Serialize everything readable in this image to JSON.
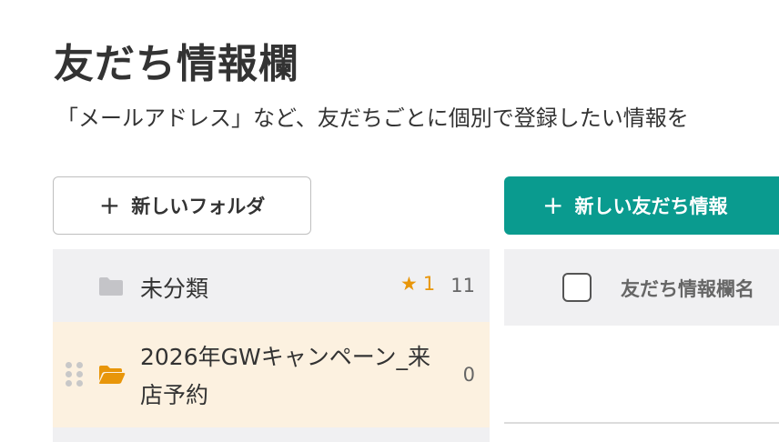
{
  "page": {
    "title": "友だち情報欄",
    "description": "「メールアドレス」など、友だちごとに個別で登録したい情報を"
  },
  "toolbar": {
    "new_folder_label": "新しいフォルダ",
    "new_friend_info_label": "新しい友だち情報",
    "plus_glyph": "+"
  },
  "folders": [
    {
      "name": "未分類",
      "starred_count": "1",
      "count": "11",
      "icon": "folder-icon",
      "selected": false
    },
    {
      "name": "2026年GWキャンペーン_来店予約",
      "count": "0",
      "icon": "folder-open-icon",
      "selected": true
    }
  ],
  "table": {
    "column_name": "友だち情報欄名"
  },
  "colors": {
    "accent": "#0a9b8f",
    "star": "#e8960a",
    "folder_gray": "#c4c4c8",
    "folder_orange": "#e8960a",
    "selected_row": "#fcf1e0"
  }
}
